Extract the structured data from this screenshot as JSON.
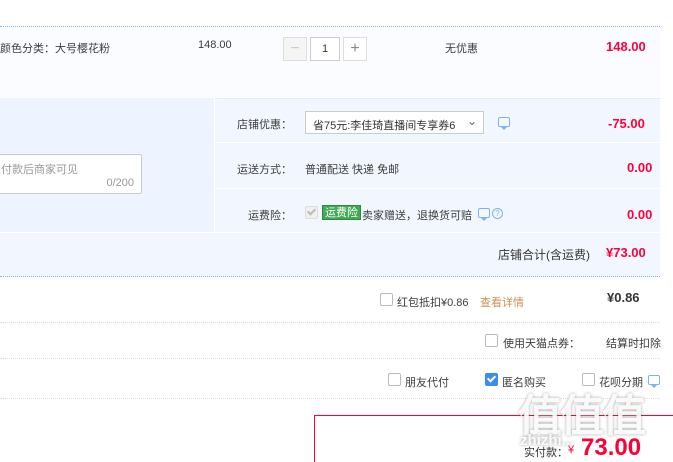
{
  "item": {
    "sku": "颜色分类：大号樱花粉",
    "unit_price": "148.00",
    "quantity": "1",
    "minus": "−",
    "plus": "+",
    "discount": "无优惠",
    "total": "148.00"
  },
  "options": {
    "shop_discount_label": "店铺优惠：",
    "shop_discount_value": "省75元:李佳琦直播间专享券6",
    "shop_discount_amount": "-75.00",
    "shipping_label": "运送方式：",
    "shipping_value": "普通配送 快递 免邮",
    "shipping_amount": "0.00",
    "insurance_label": "运费险：",
    "insurance_badge": "运费险",
    "insurance_desc": "卖家赠送，退换货可赔",
    "insurance_amount": "0.00",
    "message_placeholder": "付款后商家可见",
    "message_counter": "0/200"
  },
  "summary": {
    "shop_total_label": "店铺合计(含运费)",
    "shop_total_value": "¥73.00"
  },
  "redpacket": {
    "label": "红包抵扣¥0.86",
    "link": "查看详情",
    "amount": "¥0.86"
  },
  "tmall_points": {
    "label": "使用天猫点券：",
    "note": "结算时扣除"
  },
  "payment_options": {
    "friend_pay": "朋友代付",
    "anonymous": "匿名购买",
    "huabei": "花呗分期"
  },
  "pay": {
    "label": "实付款：",
    "currency": "¥",
    "amount": "73.00"
  },
  "watermark": {
    "logo": "值值值",
    "site": "zhizhi..."
  },
  "colors": {
    "accent_red": "#ff0036",
    "link_blue": "#3c8cf0",
    "badge_green": "#41a853"
  }
}
